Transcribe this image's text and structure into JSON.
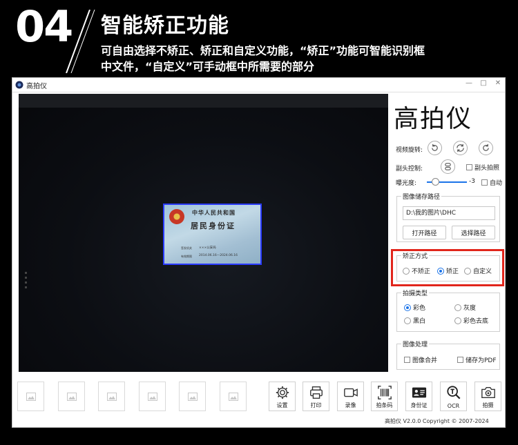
{
  "banner": {
    "number": "04",
    "title": "智能矫正功能",
    "desc_line1": "可自由选择不矫正、矫正和自定义功能，“矫正”功能可智能识别框",
    "desc_line2": "中文件，“自定义”可手动框中所需要的部分"
  },
  "window": {
    "title": "高拍仪",
    "controls": {
      "minimize": "—",
      "maximize": "□",
      "close": "✕"
    }
  },
  "preview": {
    "card": {
      "line1": "中华人民共和国",
      "line2": "居民身份证",
      "authority_label": "签发机关",
      "authority_value": "×××公安局",
      "validity_label": "有效期限",
      "validity_value": "2014.06.16—2024.06.16"
    }
  },
  "panel": {
    "brand": "高拍仪",
    "rotate_label": "视频旋转:",
    "camera_label": "副头控制:",
    "camera_checkbox": "副头拍照",
    "exposure_label": "曝光度:",
    "exposure_value": "-3",
    "auto_label": "自动",
    "save_path": {
      "title": "图像储存路径",
      "value": "D:\\我的图片\\DHC",
      "open_button": "打开路径",
      "select_button": "选择路径"
    },
    "correction": {
      "title": "矫正方式",
      "options": [
        "不矫正",
        "矫正",
        "自定义"
      ],
      "selected": "矫正"
    },
    "capture_type": {
      "title": "拍摄类型",
      "options": [
        "彩色",
        "灰度",
        "黑白",
        "彩色去底"
      ],
      "selected": "彩色"
    },
    "image_processing": {
      "title": "图像处理",
      "merge": "图像合并",
      "save_pdf": "储存为PDF"
    }
  },
  "toolbar": {
    "settings": "设置",
    "print": "打印",
    "record": "录像",
    "barcode": "拍条码",
    "idcard": "身份证",
    "ocr": "OCR",
    "capture": "拍摄"
  },
  "footer": {
    "copyright": "高拍仪 V2.0.0 Copyright © 2007-2024"
  },
  "colors": {
    "accent": "#1a73e8",
    "highlight": "#e1251b",
    "card_frame": "#2a3bff"
  }
}
